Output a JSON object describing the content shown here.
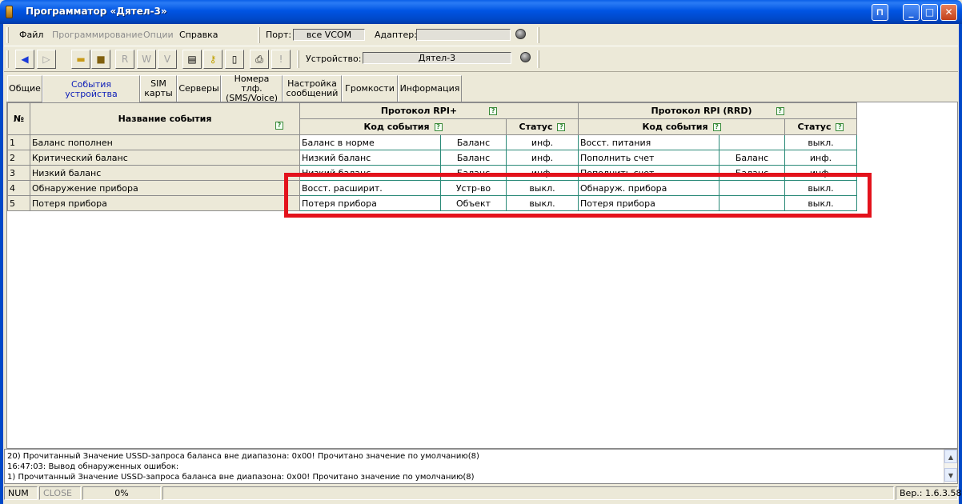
{
  "window": {
    "title": "Программатор «Дятел-3»"
  },
  "menu": {
    "file": "Файл",
    "programming": "Программирование",
    "options": "Опции",
    "help": "Справка",
    "port_label": "Порт:",
    "port_value": "все VCOM",
    "adapter_label": "Адаптер:",
    "adapter_value": ""
  },
  "toolbar": {
    "device_label": "Устройство:",
    "device_value": "Дятел-3"
  },
  "tabs": [
    "Общие",
    "События устройства",
    "SIM\nкарты",
    "Серверы",
    "Номера тлф.\n(SMS/Voice)",
    "Настройка\nсообщений",
    "Громкости",
    "Информация"
  ],
  "table": {
    "col_num": "№",
    "col_name": "Название события",
    "group_rpi_plus": "Протокол RPI+",
    "group_rpi_rrd": "Протокол RPI (RRD)",
    "code_header": "Код события",
    "status_header": "Статус",
    "rows": [
      {
        "num": "1",
        "name": "Баланс пополнен",
        "p_code": "Баланс в  норме",
        "p_sub": "Баланс",
        "p_status": "инф.",
        "r_code": "Восст. питания",
        "r_sub": "",
        "r_status": "выкл."
      },
      {
        "num": "2",
        "name": "Критический баланс",
        "p_code": "Низкий баланс",
        "p_sub": "Баланс",
        "p_status": "инф.",
        "r_code": "Пополнить счет",
        "r_sub": "Баланс",
        "r_status": "инф."
      },
      {
        "num": "3",
        "name": "Низкий баланс",
        "p_code": "Низкий баланс",
        "p_sub": "Баланс",
        "p_status": "инф.",
        "r_code": "Пополнить счет",
        "r_sub": "Баланс",
        "r_status": "инф."
      },
      {
        "num": "4",
        "name": "Обнаружение прибора",
        "p_code": "Восст. расширит.",
        "p_sub": "Устр-во",
        "p_status": "выкл.",
        "r_code": "Обнаруж. прибора",
        "r_sub": "",
        "r_status": "выкл."
      },
      {
        "num": "5",
        "name": "Потеря прибора",
        "p_code": "Потеря прибора",
        "p_sub": "Объект",
        "p_status": "выкл.",
        "r_code": "Потеря прибора",
        "r_sub": "",
        "r_status": "выкл."
      }
    ]
  },
  "log": [
    "20) Прочитанный Значение USSD-запроса баланса вне диапазона: 0x00! Прочитано значение по умолчанию(8)",
    "16:47:03: Вывод обнаруженных ошибок:",
    "1) Прочитанный Значение USSD-запроса баланса вне диапазона: 0x00! Прочитано значение по умолчанию(8)"
  ],
  "status": {
    "num": "NUM",
    "close": "CLOSE",
    "progress": "0%",
    "version": "Вер.: 1.6.3.58"
  },
  "colors": {
    "highlight": "#e3121c",
    "titlebar": "#0054e3",
    "active_tab_text": "#1020b8"
  }
}
